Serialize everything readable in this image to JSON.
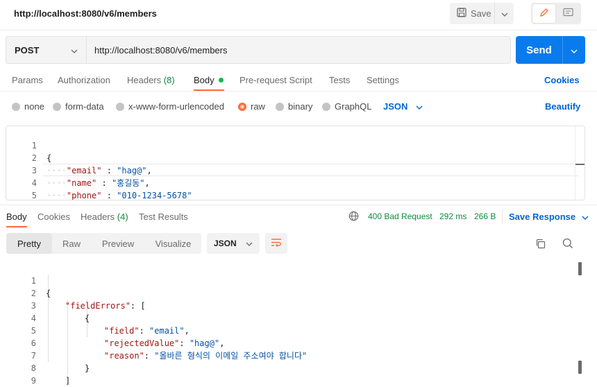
{
  "window": {
    "title": "http://localhost:8080/v6/members",
    "save_label": "Save"
  },
  "request": {
    "method": "POST",
    "url": "http://localhost:8080/v6/members",
    "send_label": "Send"
  },
  "request_tabs": {
    "params": "Params",
    "authorization": "Authorization",
    "headers": "Headers",
    "headers_count": "(8)",
    "body": "Body",
    "prerequest": "Pre-request Script",
    "tests": "Tests",
    "settings": "Settings",
    "cookies": "Cookies"
  },
  "body_types": {
    "none": "none",
    "form_data": "form-data",
    "urlencoded": "x-www-form-urlencoded",
    "raw": "raw",
    "binary": "binary",
    "graphql": "GraphQL",
    "language": "JSON",
    "beautify": "Beautify",
    "selected": "raw"
  },
  "request_body": {
    "line_numbers": [
      "1",
      "2",
      "3",
      "4",
      "5"
    ],
    "open": "{",
    "close": "}",
    "fields": [
      {
        "key": "\"email\"",
        "sep": " : ",
        "value": "\"hag@\"",
        "trail": ","
      },
      {
        "key": "\"name\"",
        "sep": " : ",
        "value": "\"홍길동\"",
        "trail": ","
      },
      {
        "key": "\"phone\"",
        "sep": " : ",
        "value": "\"010-1234-5678\"",
        "trail": ""
      }
    ]
  },
  "response_tabs": {
    "body": "Body",
    "cookies": "Cookies",
    "headers": "Headers",
    "headers_count": "(4)",
    "test_results": "Test Results"
  },
  "response_status": {
    "status": "400 Bad Request",
    "time": "292 ms",
    "size": "266 B",
    "save_response": "Save Response"
  },
  "response_view": {
    "pretty": "Pretty",
    "raw": "Raw",
    "preview": "Preview",
    "visualize": "Visualize",
    "format": "JSON"
  },
  "response_body": {
    "line_numbers": [
      "1",
      "2",
      "3",
      "4",
      "5",
      "6",
      "7",
      "8",
      "9"
    ],
    "l1": "{",
    "l2_key": "\"fieldErrors\"",
    "l2_rest": ": [",
    "l3": "{",
    "l4_key": "\"field\"",
    "l4_val": "\"email\"",
    "l5_key": "\"rejectedValue\"",
    "l5_val": "\"hag@\"",
    "l6_key": "\"reason\"",
    "l6_val": "\"올바른 형식의 이메일 주소여야 합니다\"",
    "l7": "}",
    "l8": "]",
    "l9": "}"
  },
  "colors": {
    "accent": "#ff6c37",
    "send": "#097bed",
    "status_green": "#0c8c3e",
    "link_blue": "#0265d2"
  }
}
